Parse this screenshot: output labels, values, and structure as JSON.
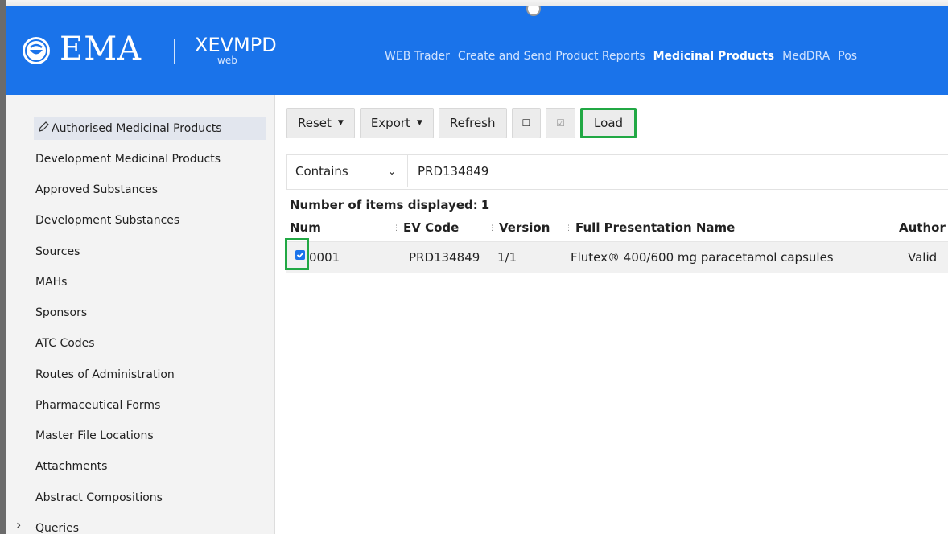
{
  "header": {
    "brand": "EMA",
    "app_name": "XEVMPD",
    "app_sub": "web",
    "nav": [
      {
        "label": "WEB Trader",
        "active": false
      },
      {
        "label": "Create and Send Product Reports",
        "active": false
      },
      {
        "label": "Medicinal Products",
        "active": true
      },
      {
        "label": "MedDRA",
        "active": false
      },
      {
        "label": "Pos",
        "active": false
      }
    ]
  },
  "sidebar": {
    "items": [
      {
        "label": "Authorised Medicinal Products",
        "selected": true,
        "icon": "pencil-icon"
      },
      {
        "label": "Development Medicinal Products"
      },
      {
        "label": "Approved Substances"
      },
      {
        "label": "Development Substances"
      },
      {
        "label": "Sources"
      },
      {
        "label": "MAHs"
      },
      {
        "label": "Sponsors"
      },
      {
        "label": "ATC Codes"
      },
      {
        "label": "Routes of Administration"
      },
      {
        "label": "Pharmaceutical Forms"
      },
      {
        "label": "Master File Locations"
      },
      {
        "label": "Attachments"
      },
      {
        "label": "Abstract Compositions"
      },
      {
        "label": "Queries",
        "expandable": true
      }
    ]
  },
  "toolbar": {
    "reset": "Reset",
    "export": "Export",
    "refresh": "Refresh",
    "select_none_icon": "☐",
    "select_all_icon": "☑",
    "load": "Load"
  },
  "filter": {
    "operator": "Contains",
    "value": "PRD134849"
  },
  "results": {
    "count_label": "Number of items displayed:",
    "count": "1",
    "columns": [
      "Num",
      "EV Code",
      "Version",
      "Full Presentation Name",
      "Author"
    ],
    "rows": [
      {
        "checked": true,
        "num": "0001",
        "ev_code": "PRD134849",
        "version": "1/1",
        "name": "Flutex® 400/600 mg paracetamol capsules",
        "auth": "Valid"
      }
    ]
  },
  "colors": {
    "header_bg": "#1a73ea",
    "highlight": "#21a844"
  }
}
